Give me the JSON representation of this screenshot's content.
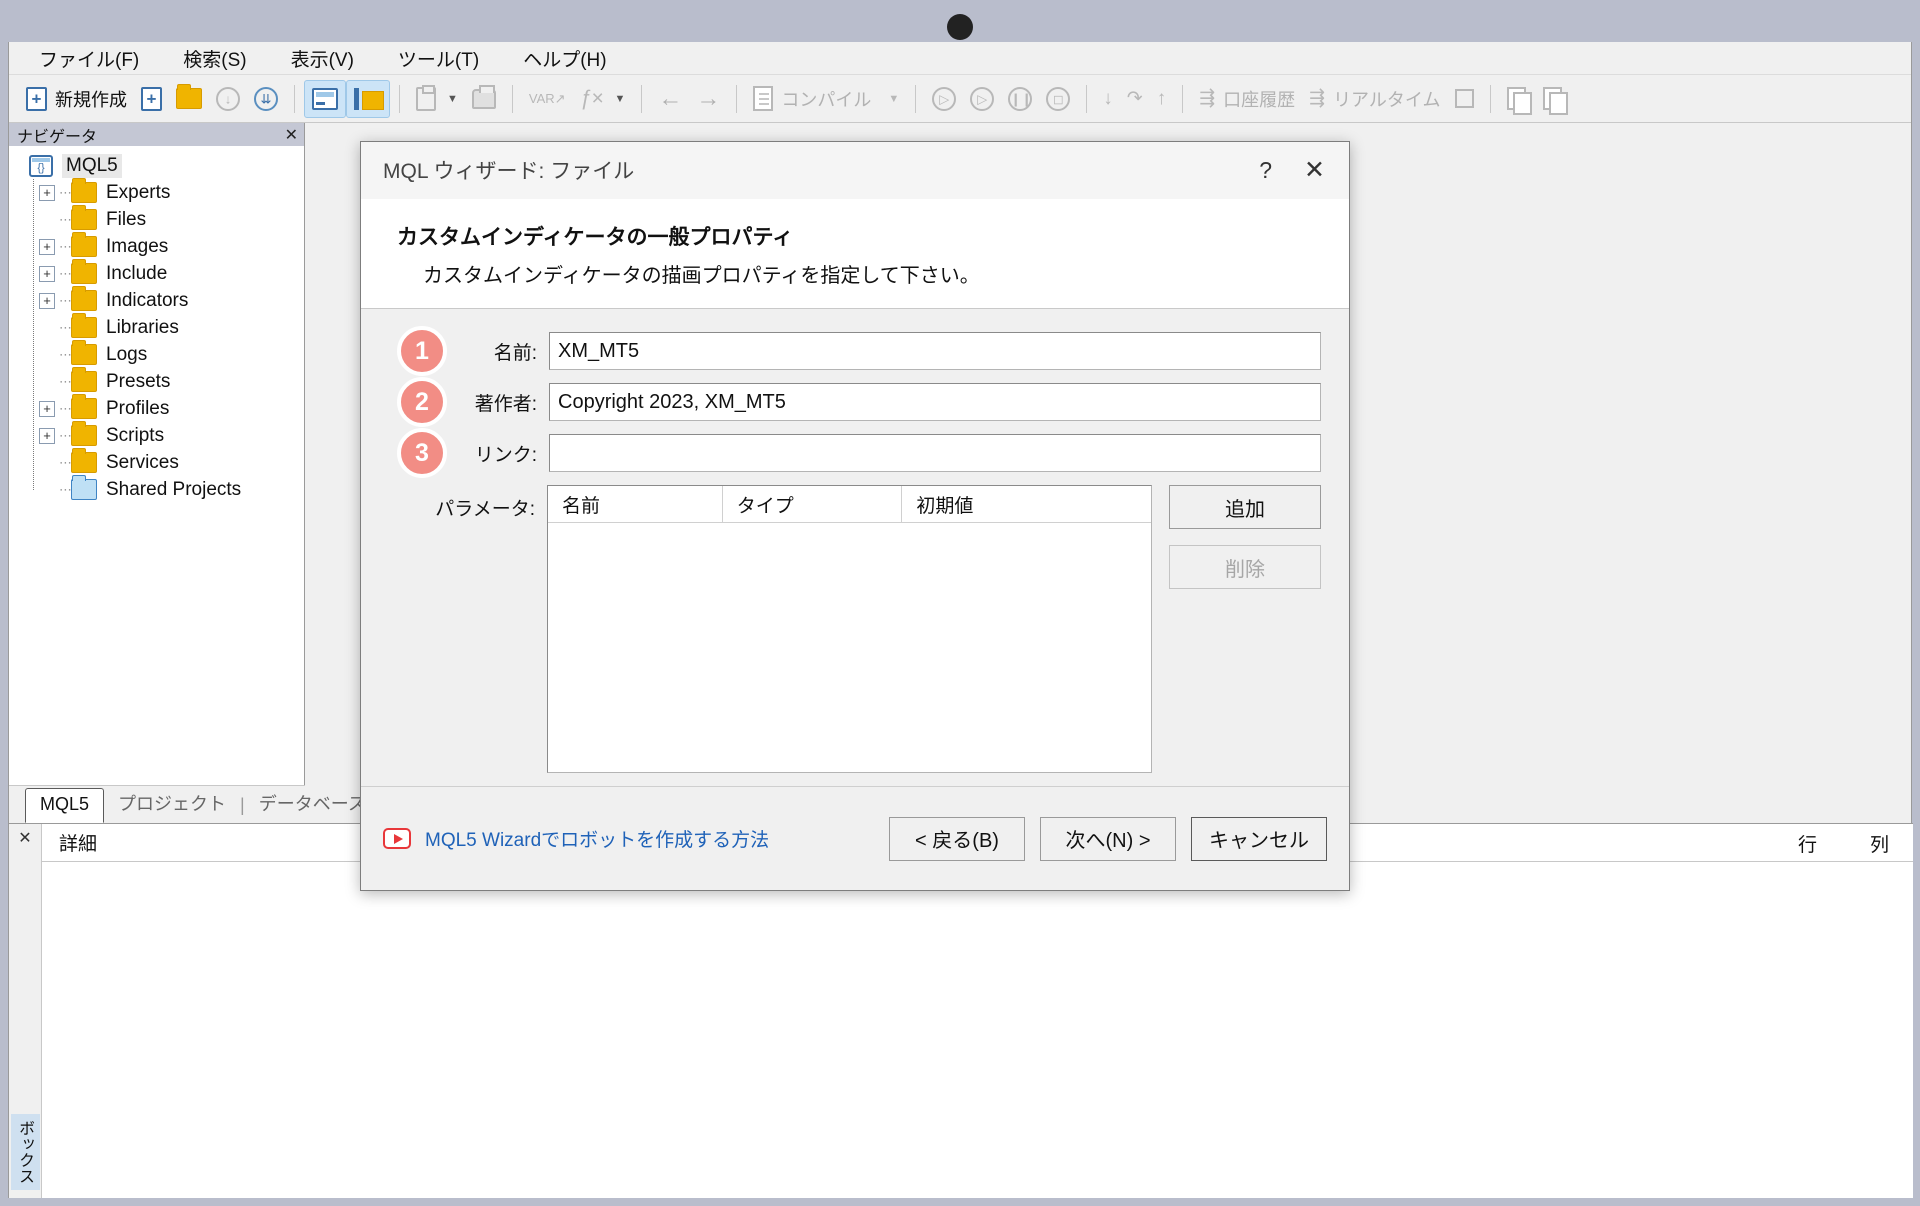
{
  "menubar": {
    "items": [
      {
        "label": "ファイル(F)",
        "name": "menu-file"
      },
      {
        "label": "検索(S)",
        "name": "menu-search"
      },
      {
        "label": "表示(V)",
        "name": "menu-view"
      },
      {
        "label": "ツール(T)",
        "name": "menu-tools"
      },
      {
        "label": "ヘルプ(H)",
        "name": "menu-help"
      }
    ]
  },
  "toolbar": {
    "new_label": "新規作成",
    "compile_label": "コンパイル",
    "account_history_label": "口座履歴",
    "realtime_label": "リアルタイム"
  },
  "navigator": {
    "title": "ナビゲータ",
    "close": "✕",
    "root": "MQL5",
    "items": [
      {
        "label": "Experts",
        "expandable": true,
        "color": "yellow"
      },
      {
        "label": "Files",
        "expandable": false,
        "color": "yellow"
      },
      {
        "label": "Images",
        "expandable": true,
        "color": "yellow"
      },
      {
        "label": "Include",
        "expandable": true,
        "color": "yellow"
      },
      {
        "label": "Indicators",
        "expandable": true,
        "color": "yellow"
      },
      {
        "label": "Libraries",
        "expandable": false,
        "color": "yellow"
      },
      {
        "label": "Logs",
        "expandable": false,
        "color": "yellow"
      },
      {
        "label": "Presets",
        "expandable": false,
        "color": "yellow"
      },
      {
        "label": "Profiles",
        "expandable": true,
        "color": "yellow"
      },
      {
        "label": "Scripts",
        "expandable": true,
        "color": "yellow"
      },
      {
        "label": "Services",
        "expandable": false,
        "color": "yellow"
      },
      {
        "label": "Shared Projects",
        "expandable": false,
        "color": "blue"
      }
    ],
    "tabs": [
      {
        "label": "MQL5",
        "active": true
      },
      {
        "label": "プロジェクト",
        "active": false
      },
      {
        "label": "データベース",
        "active": false
      }
    ],
    "tab_divider": "|"
  },
  "bottom_panel": {
    "close": "✕",
    "vtab": "ボックス",
    "detail_label": "詳細",
    "col_line": "行",
    "col_col": "列"
  },
  "dialog": {
    "title": "MQL ウィザード: ファイル",
    "help_icon": "?",
    "close_icon": "✕",
    "heading": "カスタムインディケータの一般プロパティ",
    "subheading": "カスタムインディケータの描画プロパティを指定して下さい。",
    "fields": [
      {
        "badge": "1",
        "label": "名前:",
        "value": "XM_MT5",
        "placeholder": ""
      },
      {
        "badge": "2",
        "label": "著作者:",
        "value": "Copyright 2023, XM_MT5",
        "placeholder": ""
      },
      {
        "badge": "3",
        "label": "リンク:",
        "value": "",
        "placeholder": ""
      }
    ],
    "parameters": {
      "label": "パラメータ:",
      "columns": [
        "名前",
        "タイプ",
        "初期値"
      ],
      "rows": [],
      "add_button": "追加",
      "delete_button": "削除"
    },
    "footer": {
      "link_text": "MQL5 Wizardでロボットを作成する方法",
      "back_button": "< 戻る(B)",
      "next_button": "次へ(N) >",
      "cancel_button": "キャンセル"
    }
  },
  "colors": {
    "badge": "#f28d85",
    "link": "#1f62b8",
    "folder": "#f0b400",
    "accent": "#3a6fa8"
  }
}
